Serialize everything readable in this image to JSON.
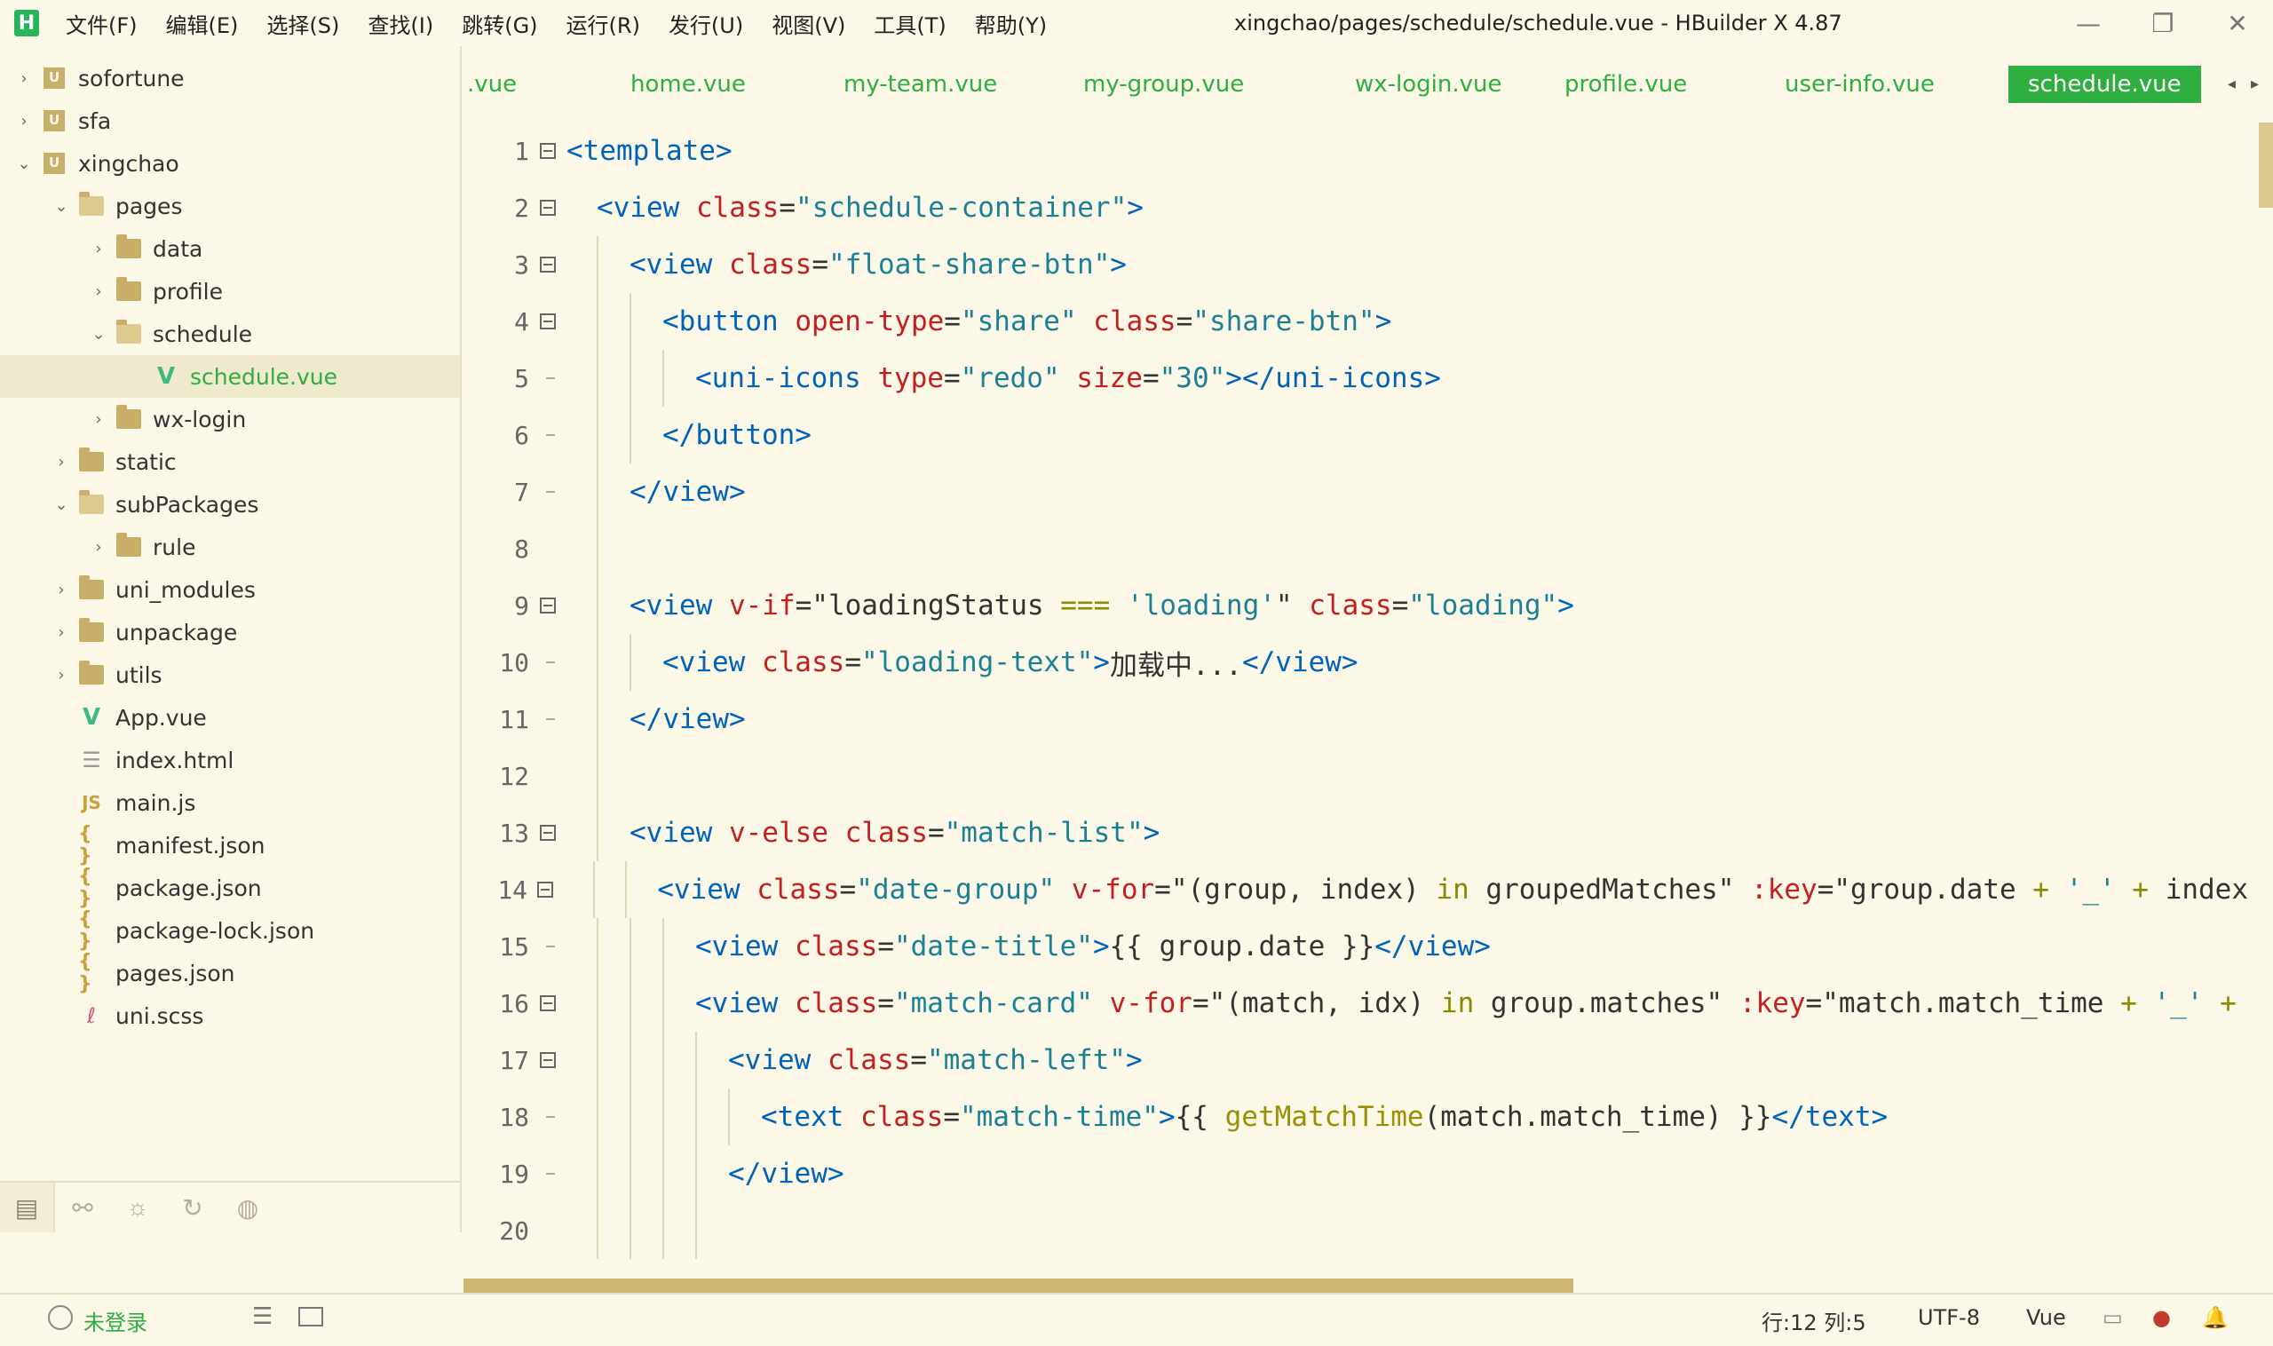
{
  "window": {
    "title": "xingchao/pages/schedule/schedule.vue - HBuilder X 4.87",
    "logo": "H",
    "controls": {
      "minimize": "—",
      "maximize": "❐",
      "close": "✕"
    }
  },
  "menu": [
    "文件(F)",
    "编辑(E)",
    "选择(S)",
    "查找(I)",
    "跳转(G)",
    "运行(R)",
    "发行(U)",
    "视图(V)",
    "工具(T)",
    "帮助(Y)"
  ],
  "tree": [
    {
      "label": "sofortune",
      "type": "project",
      "depth": 0,
      "chevron": "›"
    },
    {
      "label": "sfa",
      "type": "project",
      "depth": 0,
      "chevron": "›"
    },
    {
      "label": "xingchao",
      "type": "project",
      "depth": 0,
      "chevron": "⌄"
    },
    {
      "label": "pages",
      "type": "folder-open",
      "depth": 1,
      "chevron": "⌄"
    },
    {
      "label": "data",
      "type": "folder",
      "depth": 2,
      "chevron": "›"
    },
    {
      "label": "profile",
      "type": "folder",
      "depth": 2,
      "chevron": "›"
    },
    {
      "label": "schedule",
      "type": "folder-open",
      "depth": 2,
      "chevron": "⌄"
    },
    {
      "label": "schedule.vue",
      "type": "vue",
      "depth": 3,
      "chevron": "",
      "selected": true
    },
    {
      "label": "wx-login",
      "type": "folder",
      "depth": 2,
      "chevron": "›"
    },
    {
      "label": "static",
      "type": "folder",
      "depth": 1,
      "chevron": "›"
    },
    {
      "label": "subPackages",
      "type": "folder-open",
      "depth": 1,
      "chevron": "⌄"
    },
    {
      "label": "rule",
      "type": "folder",
      "depth": 2,
      "chevron": "›"
    },
    {
      "label": "uni_modules",
      "type": "folder",
      "depth": 1,
      "chevron": "›"
    },
    {
      "label": "unpackage",
      "type": "folder",
      "depth": 1,
      "chevron": "›"
    },
    {
      "label": "utils",
      "type": "folder",
      "depth": 1,
      "chevron": "›"
    },
    {
      "label": "App.vue",
      "type": "vue",
      "depth": 1,
      "chevron": ""
    },
    {
      "label": "index.html",
      "type": "html",
      "depth": 1,
      "chevron": ""
    },
    {
      "label": "main.js",
      "type": "js",
      "depth": 1,
      "chevron": ""
    },
    {
      "label": "manifest.json",
      "type": "json",
      "depth": 1,
      "chevron": ""
    },
    {
      "label": "package.json",
      "type": "json",
      "depth": 1,
      "chevron": ""
    },
    {
      "label": "package-lock.json",
      "type": "json",
      "depth": 1,
      "chevron": ""
    },
    {
      "label": "pages.json",
      "type": "json",
      "depth": 1,
      "chevron": ""
    },
    {
      "label": "uni.scss",
      "type": "scss",
      "depth": 1,
      "chevron": ""
    }
  ],
  "icon_glyphs": {
    "vue": "V",
    "js": "JS",
    "json": "{ }",
    "html": "☰",
    "scss": "ℓ"
  },
  "side_tabs": [
    "project-explorer-icon",
    "binoculars-icon",
    "bug-icon",
    "refresh-icon",
    "globe-icon"
  ],
  "side_tab_glyphs": [
    "▤",
    "⚯",
    "☼",
    "↻",
    "◍"
  ],
  "tabs": [
    {
      "label": ".vue",
      "active": false
    },
    {
      "label": "home.vue",
      "active": false
    },
    {
      "label": "my-team.vue",
      "active": false
    },
    {
      "label": "my-group.vue",
      "active": false
    },
    {
      "label": "wx-login.vue",
      "active": false
    },
    {
      "label": "profile.vue",
      "active": false
    },
    {
      "label": "user-info.vue",
      "active": false
    },
    {
      "label": "schedule.vue",
      "active": true
    }
  ],
  "tab_arrows": "◂ ▸",
  "code": [
    {
      "n": "1",
      "fold": "box",
      "indent": 0,
      "tokens": [
        [
          "tag",
          "<template>"
        ]
      ]
    },
    {
      "n": "2",
      "fold": "box",
      "indent": 1,
      "tokens": [
        [
          "tag",
          "<view "
        ],
        [
          "attr",
          "class"
        ],
        [
          "txt",
          "="
        ],
        [
          "str",
          "\"schedule-container\""
        ],
        [
          "tag",
          ">"
        ]
      ]
    },
    {
      "n": "3",
      "fold": "box",
      "indent": 2,
      "tokens": [
        [
          "tag",
          "<view "
        ],
        [
          "attr",
          "class"
        ],
        [
          "txt",
          "="
        ],
        [
          "str",
          "\"float-share-btn\""
        ],
        [
          "tag",
          ">"
        ]
      ]
    },
    {
      "n": "4",
      "fold": "box",
      "indent": 3,
      "tokens": [
        [
          "tag",
          "<button "
        ],
        [
          "attr",
          "open-type"
        ],
        [
          "txt",
          "="
        ],
        [
          "str",
          "\"share\" "
        ],
        [
          "attr",
          "class"
        ],
        [
          "txt",
          "="
        ],
        [
          "str",
          "\"share-btn\""
        ],
        [
          "tag",
          ">"
        ]
      ]
    },
    {
      "n": "5",
      "fold": "tick",
      "indent": 4,
      "tokens": [
        [
          "tag",
          "<uni-icons "
        ],
        [
          "attr",
          "type"
        ],
        [
          "txt",
          "="
        ],
        [
          "str",
          "\"redo\" "
        ],
        [
          "attr",
          "size"
        ],
        [
          "txt",
          "="
        ],
        [
          "str",
          "\"30\""
        ],
        [
          "tag",
          "></uni-icons>"
        ]
      ]
    },
    {
      "n": "6",
      "fold": "tick",
      "indent": 3,
      "tokens": [
        [
          "tag",
          "</button>"
        ]
      ]
    },
    {
      "n": "7",
      "fold": "tick",
      "indent": 2,
      "tokens": [
        [
          "tag",
          "</view>"
        ]
      ]
    },
    {
      "n": "8",
      "fold": "none",
      "indent": 2,
      "tokens": []
    },
    {
      "n": "9",
      "fold": "box",
      "indent": 2,
      "tokens": [
        [
          "tag",
          "<view "
        ],
        [
          "attr",
          "v-if"
        ],
        [
          "txt",
          "=\"loadingStatus "
        ],
        [
          "op",
          "==="
        ],
        [
          "txt",
          " "
        ],
        [
          "str",
          "'loading'"
        ],
        [
          "txt",
          "\" "
        ],
        [
          "attr",
          "class"
        ],
        [
          "txt",
          "="
        ],
        [
          "str",
          "\"loading\""
        ],
        [
          "tag",
          ">"
        ]
      ]
    },
    {
      "n": "10",
      "fold": "tick",
      "indent": 3,
      "tokens": [
        [
          "tag",
          "<view "
        ],
        [
          "attr",
          "class"
        ],
        [
          "txt",
          "="
        ],
        [
          "str",
          "\"loading-text\""
        ],
        [
          "tag",
          ">"
        ],
        [
          "txt",
          "加载中..."
        ],
        [
          "tag",
          "</view>"
        ]
      ]
    },
    {
      "n": "11",
      "fold": "tick",
      "indent": 2,
      "tokens": [
        [
          "tag",
          "</view>"
        ]
      ]
    },
    {
      "n": "12",
      "fold": "none",
      "indent": 2,
      "tokens": []
    },
    {
      "n": "13",
      "fold": "box",
      "indent": 2,
      "tokens": [
        [
          "tag",
          "<view "
        ],
        [
          "attr",
          "v-else "
        ],
        [
          "attr",
          "class"
        ],
        [
          "txt",
          "="
        ],
        [
          "str",
          "\"match-list\""
        ],
        [
          "tag",
          ">"
        ]
      ]
    },
    {
      "n": "14",
      "fold": "box",
      "indent": 3,
      "tokens": [
        [
          "tag",
          "<view "
        ],
        [
          "attr",
          "class"
        ],
        [
          "txt",
          "="
        ],
        [
          "str",
          "\"date-group\" "
        ],
        [
          "attr",
          "v-for"
        ],
        [
          "txt",
          "=\"(group, index) "
        ],
        [
          "kw",
          "in"
        ],
        [
          "txt",
          " groupedMatches\" "
        ],
        [
          "attr",
          ":key"
        ],
        [
          "txt",
          "=\"group.date "
        ],
        [
          "op",
          "+"
        ],
        [
          "txt",
          " "
        ],
        [
          "str",
          "'_'"
        ],
        [
          "txt",
          " "
        ],
        [
          "op",
          "+"
        ],
        [
          "txt",
          " index"
        ]
      ]
    },
    {
      "n": "15",
      "fold": "tick",
      "indent": 4,
      "tokens": [
        [
          "tag",
          "<view "
        ],
        [
          "attr",
          "class"
        ],
        [
          "txt",
          "="
        ],
        [
          "str",
          "\"date-title\""
        ],
        [
          "tag",
          ">"
        ],
        [
          "txt",
          "{{ group.date }}"
        ],
        [
          "tag",
          "</view>"
        ]
      ]
    },
    {
      "n": "16",
      "fold": "box",
      "indent": 4,
      "tokens": [
        [
          "tag",
          "<view "
        ],
        [
          "attr",
          "class"
        ],
        [
          "txt",
          "="
        ],
        [
          "str",
          "\"match-card\" "
        ],
        [
          "attr",
          "v-for"
        ],
        [
          "txt",
          "=\"(match, idx) "
        ],
        [
          "kw",
          "in"
        ],
        [
          "txt",
          " group.matches\" "
        ],
        [
          "attr",
          ":key"
        ],
        [
          "txt",
          "=\"match.match_time "
        ],
        [
          "op",
          "+"
        ],
        [
          "txt",
          " "
        ],
        [
          "str",
          "'_'"
        ],
        [
          "txt",
          " "
        ],
        [
          "op",
          "+"
        ]
      ]
    },
    {
      "n": "17",
      "fold": "box",
      "indent": 5,
      "tokens": [
        [
          "tag",
          "<view "
        ],
        [
          "attr",
          "class"
        ],
        [
          "txt",
          "="
        ],
        [
          "str",
          "\"match-left\""
        ],
        [
          "tag",
          ">"
        ]
      ]
    },
    {
      "n": "18",
      "fold": "tick",
      "indent": 6,
      "tokens": [
        [
          "tag",
          "<text "
        ],
        [
          "attr",
          "class"
        ],
        [
          "txt",
          "="
        ],
        [
          "str",
          "\"match-time\""
        ],
        [
          "tag",
          ">"
        ],
        [
          "txt",
          "{{ "
        ],
        [
          "fn",
          "getMatchTime"
        ],
        [
          "txt",
          "(match.match_time) }}"
        ],
        [
          "tag",
          "</text>"
        ]
      ]
    },
    {
      "n": "19",
      "fold": "tick",
      "indent": 5,
      "tokens": [
        [
          "tag",
          "</view>"
        ]
      ]
    },
    {
      "n": "20",
      "fold": "none",
      "indent": 5,
      "tokens": []
    }
  ],
  "status": {
    "user_icon": "user-icon",
    "login": "未登录",
    "position": "行:12  列:5",
    "encoding": "UTF-8",
    "language": "Vue",
    "list_glyph": "☰",
    "file_glyph": "▭",
    "sync_glyph": "●",
    "bell_glyph": "🔔"
  }
}
